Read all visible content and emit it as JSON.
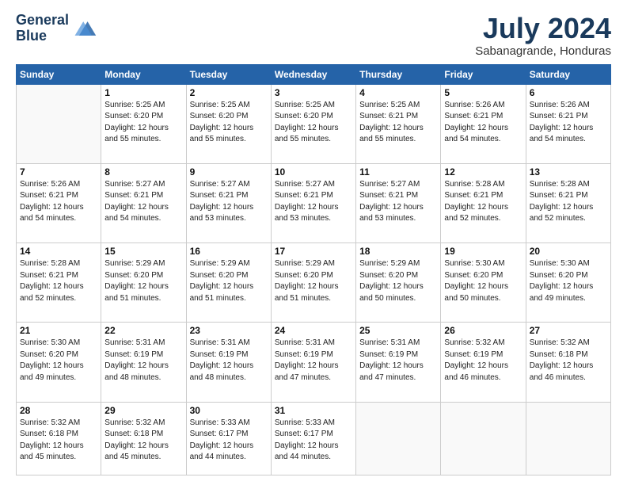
{
  "header": {
    "logo_line1": "General",
    "logo_line2": "Blue",
    "month_title": "July 2024",
    "subtitle": "Sabanagrande, Honduras"
  },
  "weekdays": [
    "Sunday",
    "Monday",
    "Tuesday",
    "Wednesday",
    "Thursday",
    "Friday",
    "Saturday"
  ],
  "weeks": [
    [
      {
        "day": "",
        "sunrise": "",
        "sunset": "",
        "daylight": ""
      },
      {
        "day": "1",
        "sunrise": "Sunrise: 5:25 AM",
        "sunset": "Sunset: 6:20 PM",
        "daylight": "Daylight: 12 hours and 55 minutes."
      },
      {
        "day": "2",
        "sunrise": "Sunrise: 5:25 AM",
        "sunset": "Sunset: 6:20 PM",
        "daylight": "Daylight: 12 hours and 55 minutes."
      },
      {
        "day": "3",
        "sunrise": "Sunrise: 5:25 AM",
        "sunset": "Sunset: 6:20 PM",
        "daylight": "Daylight: 12 hours and 55 minutes."
      },
      {
        "day": "4",
        "sunrise": "Sunrise: 5:25 AM",
        "sunset": "Sunset: 6:21 PM",
        "daylight": "Daylight: 12 hours and 55 minutes."
      },
      {
        "day": "5",
        "sunrise": "Sunrise: 5:26 AM",
        "sunset": "Sunset: 6:21 PM",
        "daylight": "Daylight: 12 hours and 54 minutes."
      },
      {
        "day": "6",
        "sunrise": "Sunrise: 5:26 AM",
        "sunset": "Sunset: 6:21 PM",
        "daylight": "Daylight: 12 hours and 54 minutes."
      }
    ],
    [
      {
        "day": "7",
        "sunrise": "Sunrise: 5:26 AM",
        "sunset": "Sunset: 6:21 PM",
        "daylight": "Daylight: 12 hours and 54 minutes."
      },
      {
        "day": "8",
        "sunrise": "Sunrise: 5:27 AM",
        "sunset": "Sunset: 6:21 PM",
        "daylight": "Daylight: 12 hours and 54 minutes."
      },
      {
        "day": "9",
        "sunrise": "Sunrise: 5:27 AM",
        "sunset": "Sunset: 6:21 PM",
        "daylight": "Daylight: 12 hours and 53 minutes."
      },
      {
        "day": "10",
        "sunrise": "Sunrise: 5:27 AM",
        "sunset": "Sunset: 6:21 PM",
        "daylight": "Daylight: 12 hours and 53 minutes."
      },
      {
        "day": "11",
        "sunrise": "Sunrise: 5:27 AM",
        "sunset": "Sunset: 6:21 PM",
        "daylight": "Daylight: 12 hours and 53 minutes."
      },
      {
        "day": "12",
        "sunrise": "Sunrise: 5:28 AM",
        "sunset": "Sunset: 6:21 PM",
        "daylight": "Daylight: 12 hours and 52 minutes."
      },
      {
        "day": "13",
        "sunrise": "Sunrise: 5:28 AM",
        "sunset": "Sunset: 6:21 PM",
        "daylight": "Daylight: 12 hours and 52 minutes."
      }
    ],
    [
      {
        "day": "14",
        "sunrise": "Sunrise: 5:28 AM",
        "sunset": "Sunset: 6:21 PM",
        "daylight": "Daylight: 12 hours and 52 minutes."
      },
      {
        "day": "15",
        "sunrise": "Sunrise: 5:29 AM",
        "sunset": "Sunset: 6:20 PM",
        "daylight": "Daylight: 12 hours and 51 minutes."
      },
      {
        "day": "16",
        "sunrise": "Sunrise: 5:29 AM",
        "sunset": "Sunset: 6:20 PM",
        "daylight": "Daylight: 12 hours and 51 minutes."
      },
      {
        "day": "17",
        "sunrise": "Sunrise: 5:29 AM",
        "sunset": "Sunset: 6:20 PM",
        "daylight": "Daylight: 12 hours and 51 minutes."
      },
      {
        "day": "18",
        "sunrise": "Sunrise: 5:29 AM",
        "sunset": "Sunset: 6:20 PM",
        "daylight": "Daylight: 12 hours and 50 minutes."
      },
      {
        "day": "19",
        "sunrise": "Sunrise: 5:30 AM",
        "sunset": "Sunset: 6:20 PM",
        "daylight": "Daylight: 12 hours and 50 minutes."
      },
      {
        "day": "20",
        "sunrise": "Sunrise: 5:30 AM",
        "sunset": "Sunset: 6:20 PM",
        "daylight": "Daylight: 12 hours and 49 minutes."
      }
    ],
    [
      {
        "day": "21",
        "sunrise": "Sunrise: 5:30 AM",
        "sunset": "Sunset: 6:20 PM",
        "daylight": "Daylight: 12 hours and 49 minutes."
      },
      {
        "day": "22",
        "sunrise": "Sunrise: 5:31 AM",
        "sunset": "Sunset: 6:19 PM",
        "daylight": "Daylight: 12 hours and 48 minutes."
      },
      {
        "day": "23",
        "sunrise": "Sunrise: 5:31 AM",
        "sunset": "Sunset: 6:19 PM",
        "daylight": "Daylight: 12 hours and 48 minutes."
      },
      {
        "day": "24",
        "sunrise": "Sunrise: 5:31 AM",
        "sunset": "Sunset: 6:19 PM",
        "daylight": "Daylight: 12 hours and 47 minutes."
      },
      {
        "day": "25",
        "sunrise": "Sunrise: 5:31 AM",
        "sunset": "Sunset: 6:19 PM",
        "daylight": "Daylight: 12 hours and 47 minutes."
      },
      {
        "day": "26",
        "sunrise": "Sunrise: 5:32 AM",
        "sunset": "Sunset: 6:19 PM",
        "daylight": "Daylight: 12 hours and 46 minutes."
      },
      {
        "day": "27",
        "sunrise": "Sunrise: 5:32 AM",
        "sunset": "Sunset: 6:18 PM",
        "daylight": "Daylight: 12 hours and 46 minutes."
      }
    ],
    [
      {
        "day": "28",
        "sunrise": "Sunrise: 5:32 AM",
        "sunset": "Sunset: 6:18 PM",
        "daylight": "Daylight: 12 hours and 45 minutes."
      },
      {
        "day": "29",
        "sunrise": "Sunrise: 5:32 AM",
        "sunset": "Sunset: 6:18 PM",
        "daylight": "Daylight: 12 hours and 45 minutes."
      },
      {
        "day": "30",
        "sunrise": "Sunrise: 5:33 AM",
        "sunset": "Sunset: 6:17 PM",
        "daylight": "Daylight: 12 hours and 44 minutes."
      },
      {
        "day": "31",
        "sunrise": "Sunrise: 5:33 AM",
        "sunset": "Sunset: 6:17 PM",
        "daylight": "Daylight: 12 hours and 44 minutes."
      },
      {
        "day": "",
        "sunrise": "",
        "sunset": "",
        "daylight": ""
      },
      {
        "day": "",
        "sunrise": "",
        "sunset": "",
        "daylight": ""
      },
      {
        "day": "",
        "sunrise": "",
        "sunset": "",
        "daylight": ""
      }
    ]
  ]
}
